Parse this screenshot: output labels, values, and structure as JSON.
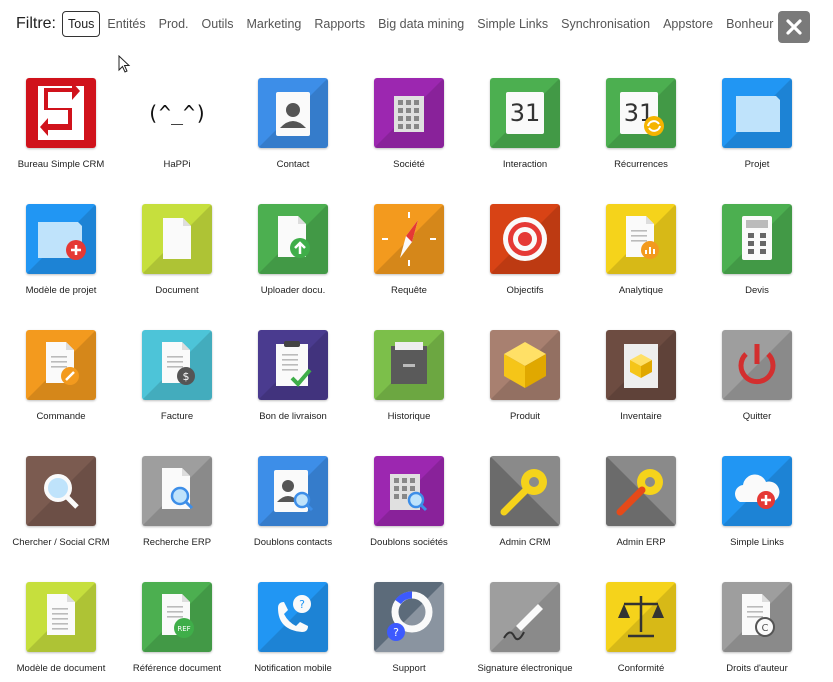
{
  "filter": {
    "label": "Filtre:",
    "tabs": [
      "Tous",
      "Entités",
      "Prod.",
      "Outils",
      "Marketing",
      "Rapports",
      "Big data mining",
      "Simple Links",
      "Synchronisation",
      "Appstore",
      "Bonheur"
    ],
    "active": "Tous"
  },
  "close_icon": "close-icon",
  "apps": [
    {
      "label": "Bureau Simple CRM",
      "icon": "simple-crm-logo-icon",
      "color": "#d0121b"
    },
    {
      "label": "HaPPi",
      "icon": "happi-face-icon",
      "color": "#ffffff",
      "glyph": "(^_^)"
    },
    {
      "label": "Contact",
      "icon": "contact-card-icon",
      "color": "#3d8ee8"
    },
    {
      "label": "Société",
      "icon": "building-icon",
      "color": "#9c27b0"
    },
    {
      "label": "Interaction",
      "icon": "calendar-icon",
      "color": "#4caf50",
      "glyph": "31"
    },
    {
      "label": "Récurrences",
      "icon": "calendar-recurring-icon",
      "color": "#4caf50",
      "glyph": "31"
    },
    {
      "label": "Projet",
      "icon": "folder-icon",
      "color": "#2196f3"
    },
    {
      "label": "Modèle de projet",
      "icon": "folder-add-icon",
      "color": "#2196f3"
    },
    {
      "label": "Document",
      "icon": "document-icon",
      "color": "#c6df3d"
    },
    {
      "label": "Uploader docu.",
      "icon": "document-upload-icon",
      "color": "#4caf50"
    },
    {
      "label": "Requête",
      "icon": "compass-icon",
      "color": "#f39a1e"
    },
    {
      "label": "Objectifs",
      "icon": "target-icon",
      "color": "#d84315"
    },
    {
      "label": "Analytique",
      "icon": "document-chart-icon",
      "color": "#f5d31b"
    },
    {
      "label": "Devis",
      "icon": "calculator-icon",
      "color": "#4caf50"
    },
    {
      "label": "Commande",
      "icon": "document-pen-icon",
      "color": "#f39a1e"
    },
    {
      "label": "Facture",
      "icon": "document-dollar-icon",
      "color": "#4dc4d8"
    },
    {
      "label": "Bon de livraison",
      "icon": "clipboard-check-icon",
      "color": "#4a3b8f"
    },
    {
      "label": "Historique",
      "icon": "archive-drawer-icon",
      "color": "#7cbf4a"
    },
    {
      "label": "Produit",
      "icon": "cube-icon",
      "color": "#a88070"
    },
    {
      "label": "Inventaire",
      "icon": "inventory-box-icon",
      "color": "#6d4c41"
    },
    {
      "label": "Quitter",
      "icon": "power-icon",
      "color": "#9e9e9e"
    },
    {
      "label": "Chercher / Social CRM",
      "icon": "search-icon",
      "color": "#7b5b50"
    },
    {
      "label": "Recherche ERP",
      "icon": "document-search-icon",
      "color": "#9e9e9e"
    },
    {
      "label": "Doublons contacts",
      "icon": "contact-search-icon",
      "color": "#3d8ee8"
    },
    {
      "label": "Doublons sociétés",
      "icon": "building-search-icon",
      "color": "#9c27b0"
    },
    {
      "label": "Admin CRM",
      "icon": "wrench-gear-icon",
      "color": "#8a8a8a"
    },
    {
      "label": "Admin ERP",
      "icon": "wrench-gear-red-icon",
      "color": "#8a8a8a"
    },
    {
      "label": "Simple Links",
      "icon": "cloud-add-icon",
      "color": "#2196f3"
    },
    {
      "label": "",
      "icon": "document-lines-icon",
      "color": "#c6df3d"
    },
    {
      "label": "",
      "icon": "document-ref-icon",
      "color": "#4caf50"
    },
    {
      "label": "",
      "icon": "phone-help-icon",
      "color": "#2196f3"
    },
    {
      "label": "",
      "icon": "lifebuoy-help-icon",
      "color": "#5c6b7a"
    },
    {
      "label": "",
      "icon": "signature-pen-icon",
      "color": "#9e9e9e"
    },
    {
      "label": "",
      "icon": "scales-icon",
      "color": "#f5d31b"
    },
    {
      "label": "",
      "icon": "document-copyright-icon",
      "color": "#9e9e9e"
    }
  ],
  "partial_labels": [
    "Modèle de document",
    "Référence document",
    "Notification mobile",
    "Support",
    "Signature électronique",
    "Conformité",
    "Droits d'auteur"
  ]
}
